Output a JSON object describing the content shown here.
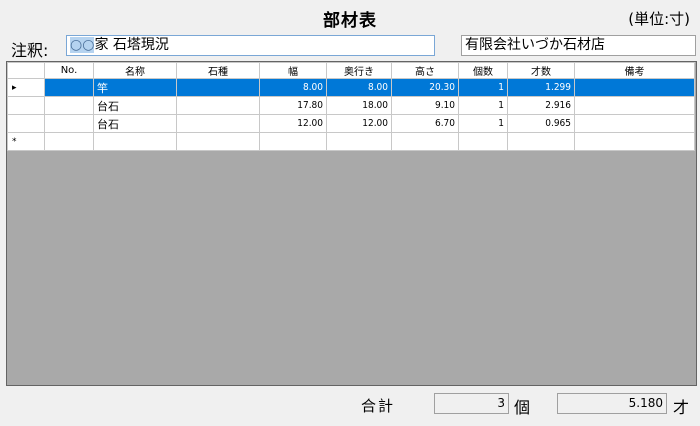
{
  "header": {
    "title": "部材表",
    "unit": "(単位:寸)"
  },
  "note": {
    "label": "注釈:",
    "highlight": "○○",
    "value": "家 石塔現況"
  },
  "company": "有限会社いづか石材店",
  "grid": {
    "columns": [
      "No.",
      "名称",
      "石種",
      "幅",
      "奥行き",
      "高さ",
      "個数",
      "才数",
      "備考"
    ],
    "rows": [
      {
        "marker": "▸",
        "no": "",
        "name": "竿",
        "stone": "",
        "width": "8.00",
        "depth": "8.00",
        "height": "20.30",
        "count": "1",
        "sai": "1.299",
        "note": "",
        "selected": true
      },
      {
        "marker": "",
        "no": "",
        "name": "台石",
        "stone": "",
        "width": "17.80",
        "depth": "18.00",
        "height": "9.10",
        "count": "1",
        "sai": "2.916",
        "note": ""
      },
      {
        "marker": "",
        "no": "",
        "name": "台石",
        "stone": "",
        "width": "12.00",
        "depth": "12.00",
        "height": "6.70",
        "count": "1",
        "sai": "0.965",
        "note": ""
      }
    ],
    "new_row_marker": "*"
  },
  "footer": {
    "label": "合計",
    "count": "3",
    "count_unit": "個",
    "total": "5.180",
    "total_unit": "才"
  },
  "colors": {
    "selection": "#0078d7",
    "grid_empty": "#a9a9a9",
    "background": "#f0f0f0"
  }
}
